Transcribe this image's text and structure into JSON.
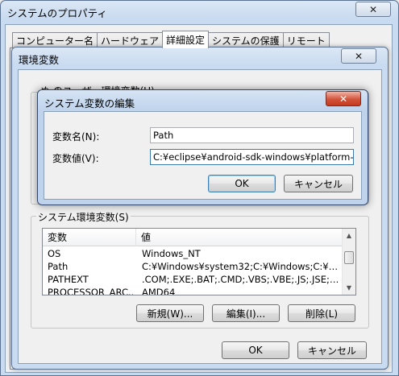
{
  "main_window": {
    "title": "システムのプロパティ",
    "tabs": [
      {
        "label": "コンピューター名"
      },
      {
        "label": "ハードウェア"
      },
      {
        "label": "詳細設定",
        "active": true
      },
      {
        "label": "システムの保護"
      },
      {
        "label": "リモート"
      }
    ]
  },
  "env_window": {
    "title": "環境変数",
    "user_section_label": "ぬ のユーザー環境変数(U)",
    "system_section_label": "システム環境変数(S)",
    "columns": [
      "変数",
      "値"
    ],
    "rows": [
      {
        "name": "OS",
        "value": "Windows_NT"
      },
      {
        "name": "Path",
        "value": "C:¥Windows¥system32;C:¥Windows;C:¥Window..."
      },
      {
        "name": "PATHEXT",
        "value": ".COM;.EXE;.BAT;.CMD;.VBS;.VBE;.JS;.JSE;.WSF;..."
      },
      {
        "name": "PROCESSOR_ARC...",
        "value": "AMD64"
      }
    ],
    "buttons": {
      "new": "新規(W)...",
      "edit": "編集(I)...",
      "delete": "削除(L)",
      "ok": "OK",
      "cancel": "キャンセル"
    }
  },
  "edit_dialog": {
    "title": "システム変数の編集",
    "name_label": "変数名(N):",
    "name_value": "Path",
    "value_label": "変数値(V):",
    "value_value": "C:¥eclipse¥android-sdk-windows¥platform-tools",
    "ok_label": "OK",
    "cancel_label": "キャンセル"
  },
  "icons": {
    "close": "close-icon",
    "scroll_up": "scroll-up-icon",
    "scroll_down": "scroll-down-icon"
  }
}
